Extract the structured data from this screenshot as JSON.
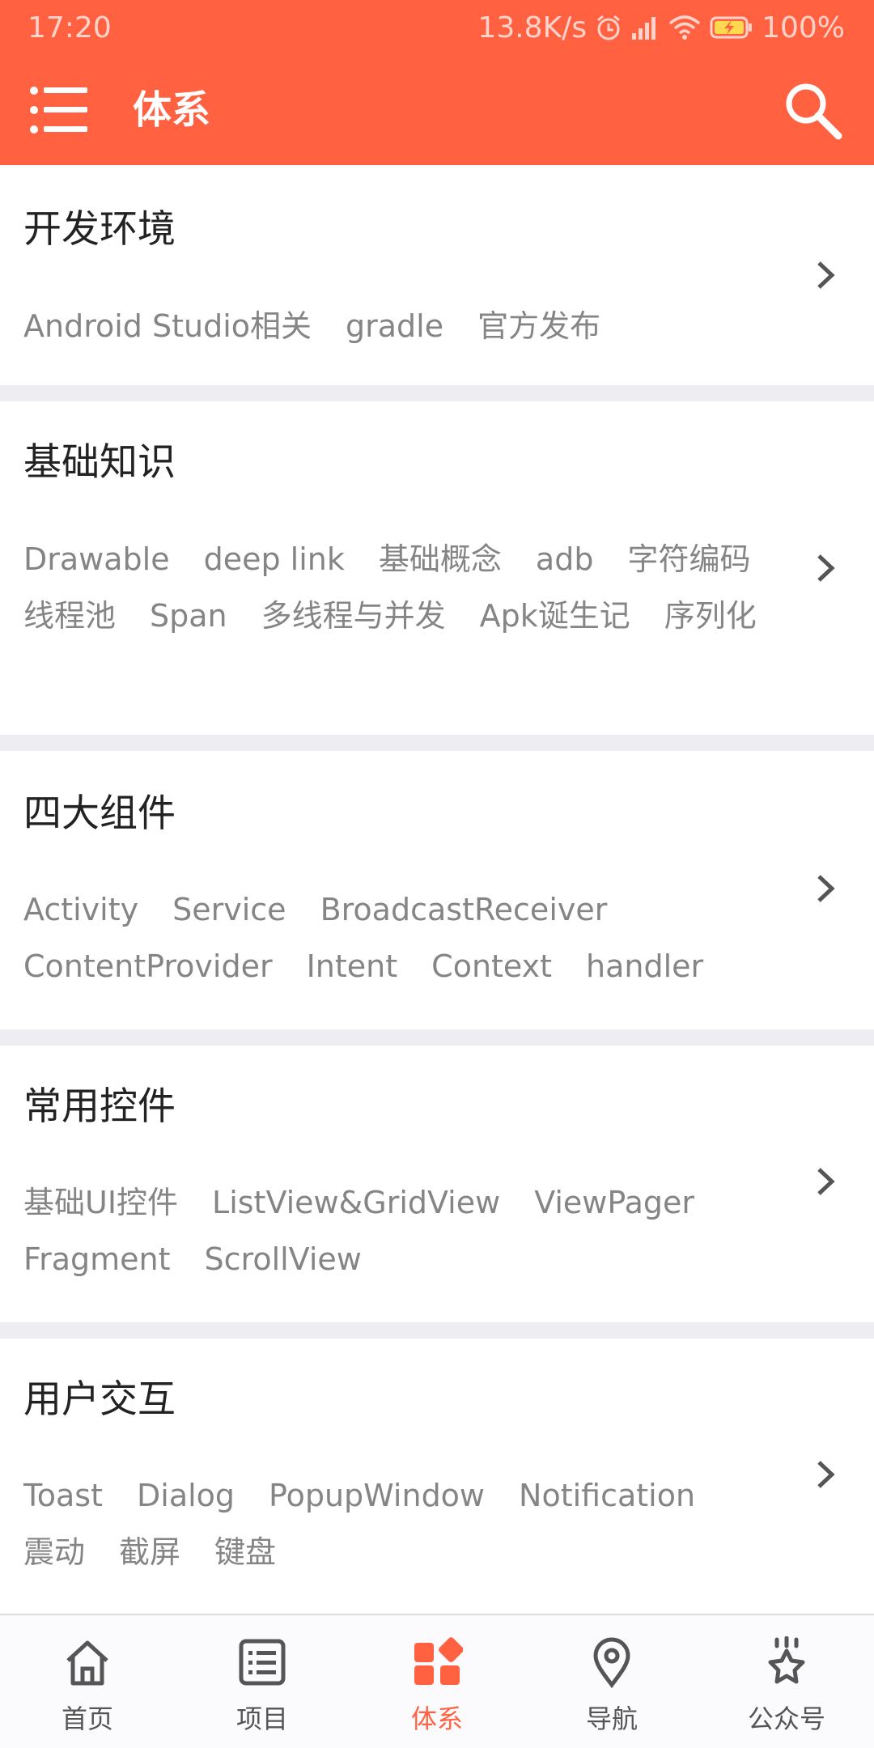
{
  "status_bar": {
    "time": "17:20",
    "net_speed": "13.8K/s",
    "battery": "100%"
  },
  "toolbar": {
    "title": "体系"
  },
  "colors": {
    "accent": "#ff6141",
    "tag_text": "#858585",
    "title_text": "#222222"
  },
  "categories": [
    {
      "title": "开发环境",
      "tags": [
        "Android Studio相关",
        "gradle",
        "官方发布"
      ]
    },
    {
      "title": "基础知识",
      "tags": [
        "Drawable",
        "deep link",
        "基础概念",
        "adb",
        "字符编码",
        "线程池",
        "Span",
        "多线程与并发",
        "Apk诞生记",
        "序列化"
      ]
    },
    {
      "title": "四大组件",
      "tags": [
        "Activity",
        "Service",
        "BroadcastReceiver",
        "ContentProvider",
        "Intent",
        "Context",
        "handler"
      ]
    },
    {
      "title": "常用控件",
      "tags": [
        "基础UI控件",
        "ListView&GridView",
        "ViewPager",
        "Fragment",
        "ScrollView"
      ]
    },
    {
      "title": "用户交互",
      "tags": [
        "Toast",
        "Dialog",
        "PopupWindow",
        "Notification",
        "震动",
        "截屏",
        "键盘"
      ]
    }
  ],
  "bottom_nav": {
    "items": [
      {
        "label": "首页",
        "icon": "home-icon"
      },
      {
        "label": "项目",
        "icon": "list-icon"
      },
      {
        "label": "体系",
        "icon": "grid-icon",
        "active": true
      },
      {
        "label": "导航",
        "icon": "location-pin-icon"
      },
      {
        "label": "公众号",
        "icon": "account-icon"
      }
    ]
  }
}
